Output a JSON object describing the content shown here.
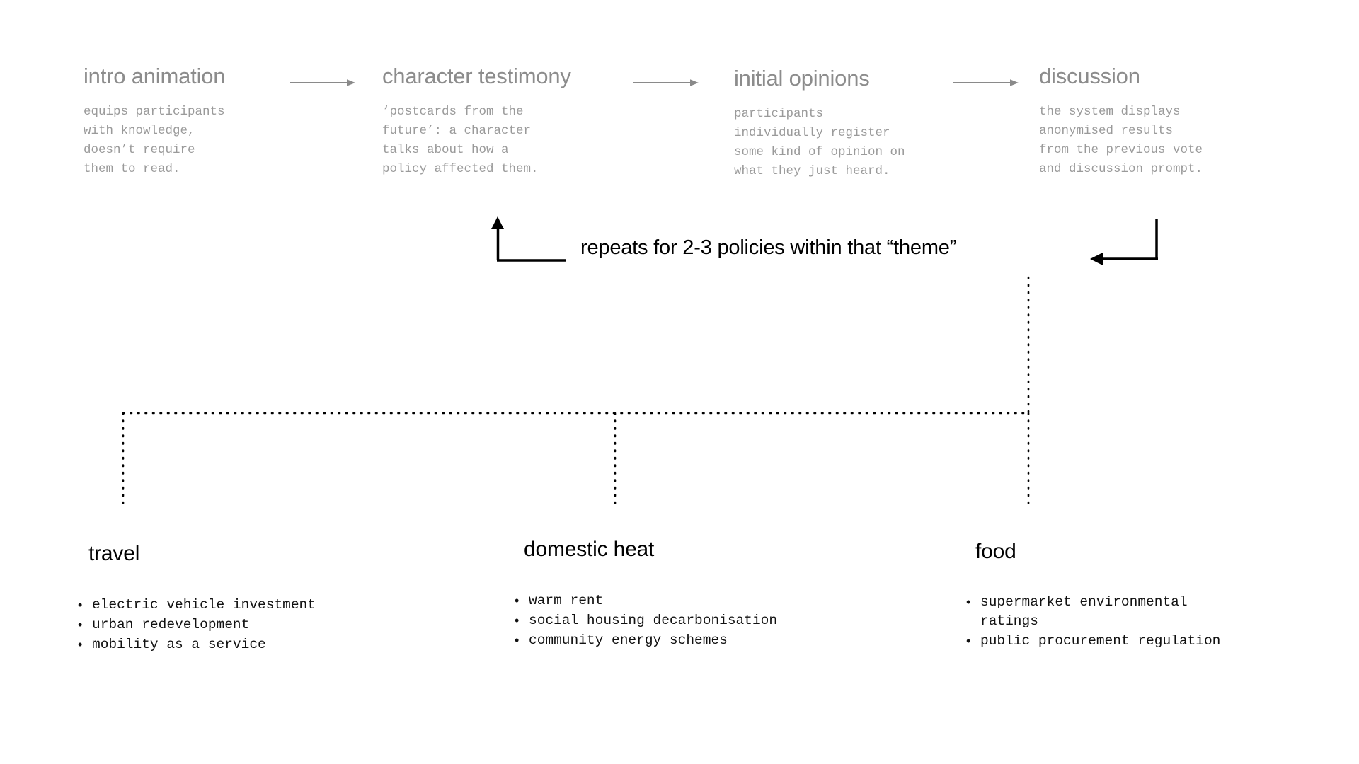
{
  "diagram": {
    "flow": {
      "stages": [
        {
          "title": "intro animation",
          "description": "equips participants\nwith knowledge,\ndoesn’t require\nthem to read."
        },
        {
          "title": "character testimony",
          "description": "‘postcards from the\nfuture’: a character\ntalks about how a\npolicy affected them."
        },
        {
          "title": "initial opinions",
          "description": "participants\nindividually register\nsome kind of opinion on\nwhat they just heard."
        },
        {
          "title": "discussion",
          "description": "the system displays\nanonymised results\nfrom the previous vote\nand discussion prompt."
        }
      ],
      "arrow_count": 3
    },
    "loop": {
      "label": "repeats for 2-3 policies within that “theme”"
    },
    "themes": [
      {
        "title": "travel",
        "items": [
          "electric vehicle investment",
          "urban redevelopment",
          "mobility as a service"
        ]
      },
      {
        "title": "domestic heat",
        "items": [
          "warm rent",
          "social housing decarbonisation",
          "community energy schemes"
        ]
      },
      {
        "title": "food",
        "items": [
          "supermarket environmental\nratings",
          "public procurement regulation"
        ]
      }
    ],
    "bullet_glyph": "•",
    "colors": {
      "background": "#ffffff",
      "stage_title": "#8c8c8c",
      "stage_description": "#9a9a9a",
      "flow_arrow": "#8a8a8a",
      "loop_line": "#000000",
      "tree_dots": "#000000",
      "theme_title": "#000000",
      "theme_item": "#111111"
    }
  }
}
